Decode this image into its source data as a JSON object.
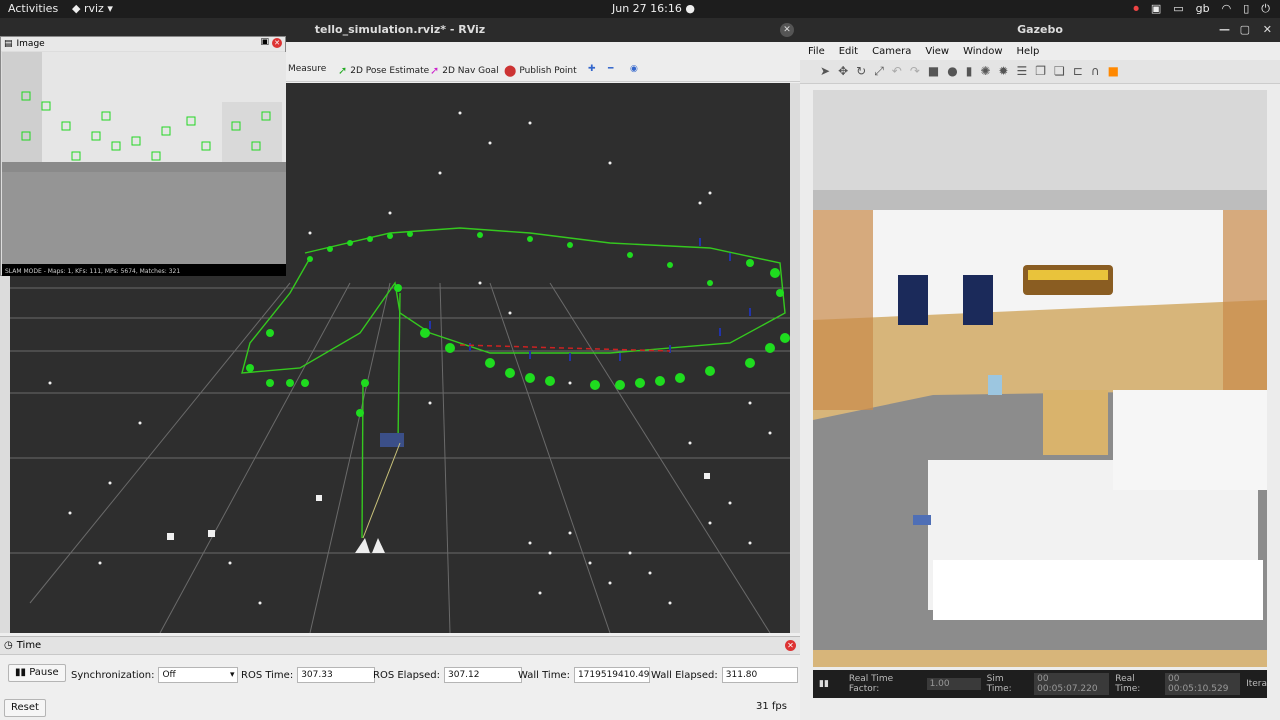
{
  "topbar": {
    "activities": "Activities",
    "app": "rviz",
    "clock": "Jun 27  16:16",
    "layout": "gb"
  },
  "rviz": {
    "title": "tello_simulation.rviz* - RViz",
    "tools": {
      "measure": "Measure",
      "pose_estimate": "2D Pose Estimate",
      "nav_goal": "2D Nav Goal",
      "publish_point": "Publish Point"
    },
    "image_panel": {
      "title": "Image",
      "status": "SLAM MODE  -  Maps: 1, KFs: 111, MPs: 5674, Matches: 321"
    },
    "time": {
      "title": "Time",
      "pause": "Pause",
      "sync_label": "Synchronization:",
      "sync_value": "Off",
      "ros_time_label": "ROS Time:",
      "ros_time": "307.33",
      "ros_elapsed_label": "ROS Elapsed:",
      "ros_elapsed": "307.12",
      "wall_time_label": "Wall Time:",
      "wall_time": "1719519410.49",
      "wall_elapsed_label": "Wall Elapsed:",
      "wall_elapsed": "311.80",
      "reset": "Reset",
      "fps": "31 fps"
    }
  },
  "gazebo": {
    "title": "Gazebo",
    "menu": [
      "File",
      "Edit",
      "Camera",
      "View",
      "Window",
      "Help"
    ],
    "status": {
      "rtf_label": "Real Time Factor:",
      "rtf": "1.00",
      "sim_label": "Sim Time:",
      "sim": "00 00:05:07.220",
      "real_label": "Real Time:",
      "real": "00 00:05:10.529",
      "iter_label": "Itera"
    }
  }
}
